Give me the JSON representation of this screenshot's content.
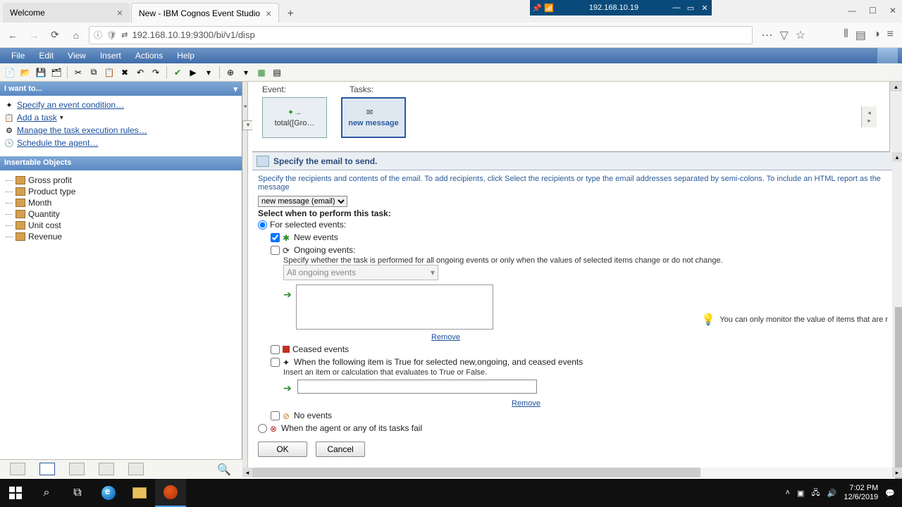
{
  "remote": {
    "ip": "192.168.10.19"
  },
  "tabs": [
    {
      "title": "Welcome",
      "active": false
    },
    {
      "title": "New - IBM Cognos Event Studio",
      "active": true
    }
  ],
  "url": "192.168.10.19:9300/bi/v1/disp",
  "menu": {
    "file": "File",
    "edit": "Edit",
    "view": "View",
    "insert": "Insert",
    "actions": "Actions",
    "help": "Help"
  },
  "want": {
    "title": "I want to...",
    "items": [
      "Specify an event condition…",
      "Add a task",
      "Manage the task execution rules…",
      "Schedule the agent…"
    ]
  },
  "insertable": {
    "title": "Insertable Objects",
    "items": [
      "Gross profit",
      "Product type",
      "Month",
      "Quantity",
      "Unit cost",
      "Revenue"
    ]
  },
  "canvas": {
    "event_label": "Event:",
    "tasks_label": "Tasks:",
    "event_card": "total([Gro…",
    "task_card": "new message"
  },
  "detail": {
    "title": "Specify the email to send.",
    "desc": "Specify the recipients and contents of the email. To add recipients, click Select the recipients or type the email addresses separated by semi-colons. To include an HTML report as the message",
    "task_select": "new message (email)",
    "section": "Select when to perform this task:",
    "for_selected": "For selected events:",
    "new_events": "New events",
    "ongoing": "Ongoing events:",
    "ongoing_hint": "Specify whether the task is performed for all ongoing events or only when the values of selected items change or do not change.",
    "ongoing_drop": "All ongoing events",
    "tip": "You can only monitor the value of items that are r",
    "remove": "Remove",
    "ceased": "Ceased events",
    "when_true": "When the following item is True for selected new,ongoing, and ceased events",
    "expr_hint": "Insert an item or calculation that evaluates to True or False.",
    "no_events": "No events",
    "agent_fail": "When the agent or any of its tasks fail",
    "ok": "OK",
    "cancel": "Cancel"
  },
  "tray": {
    "time": "7:02 PM",
    "date": "12/6/2019"
  }
}
